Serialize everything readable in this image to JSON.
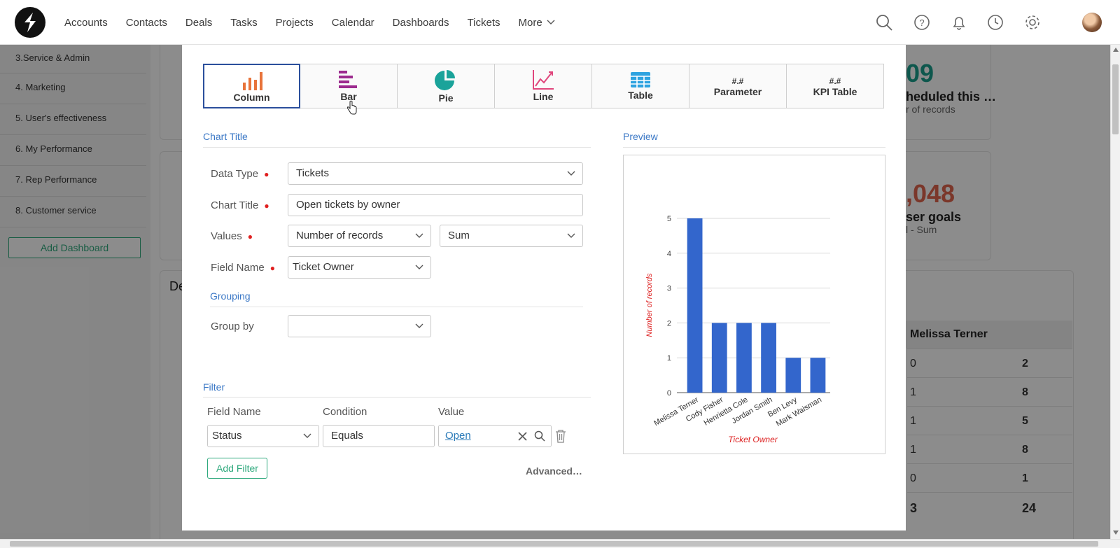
{
  "nav": {
    "items": [
      "Accounts",
      "Contacts",
      "Deals",
      "Tasks",
      "Projects",
      "Calendar",
      "Dashboards",
      "Tickets"
    ],
    "more_label": "More"
  },
  "sidebar": {
    "items": [
      "3.Service & Admin",
      "4. Marketing",
      "5. User's effectiveness",
      "6. My Performance",
      "7. Rep Performance",
      "8. Customer service"
    ],
    "add_dashboard": "Add Dashboard"
  },
  "background": {
    "kpi1_num": "09",
    "kpi1_label": "heduled this …",
    "kpi1_sub": "r of records",
    "kpi2_num": ",048",
    "kpi2_label": "ser goals",
    "kpi2_sub": "l - Sum",
    "card_title_partial": "De",
    "table_header": "Melissa Terner",
    "table_rows": [
      [
        "0",
        "2"
      ],
      [
        "1",
        "8"
      ],
      [
        "1",
        "5"
      ],
      [
        "1",
        "8"
      ],
      [
        "0",
        "1"
      ],
      [
        "3",
        "24"
      ]
    ]
  },
  "chart_types": [
    {
      "label": "Column",
      "active": true
    },
    {
      "label": "Bar",
      "active": false
    },
    {
      "label": "Pie",
      "active": false
    },
    {
      "label": "Line",
      "active": false
    },
    {
      "label": "Table",
      "active": false
    },
    {
      "label": "Parameter",
      "symbol": "#.#",
      "active": false
    },
    {
      "label": "KPI Table",
      "symbol": "#.#",
      "active": false
    }
  ],
  "form": {
    "chart_title_section": "Chart Title",
    "data_type_label": "Data Type",
    "data_type_value": "Tickets",
    "chart_title_label": "Chart Title",
    "chart_title_value": "Open tickets by owner",
    "values_label": "Values",
    "values_field": "Number of records",
    "values_agg": "Sum",
    "field_name_label": "Field Name",
    "field_name_value": "Ticket Owner",
    "grouping_section": "Grouping",
    "group_by_label": "Group by",
    "group_by_value": ""
  },
  "filter": {
    "section": "Filter",
    "col_field": "Field Name",
    "col_condition": "Condition",
    "col_value": "Value",
    "field": "Status",
    "condition": "Equals",
    "value": "Open",
    "add_filter": "Add Filter",
    "advanced": "Advanced…"
  },
  "preview": {
    "section": "Preview"
  },
  "chart_data": {
    "type": "bar",
    "categories": [
      "Melissa Terner",
      "Cody Fisher",
      "Henrietta Cole",
      "Jordan Smith",
      "Ben Levy",
      "Mark Waisman"
    ],
    "values": [
      5,
      2,
      2,
      2,
      1,
      1
    ],
    "xlabel": "Ticket Owner",
    "ylabel": "Number of records",
    "ylim": [
      0,
      5
    ],
    "yticks": [
      "0",
      "1",
      "2",
      "3",
      "4",
      "5"
    ],
    "bar_color": "#3366cc",
    "grid": true
  },
  "colors": {
    "accent": "#3b78c6",
    "green": "#2ea97d",
    "active_border": "#2b4f9c",
    "required": "#e02020"
  }
}
